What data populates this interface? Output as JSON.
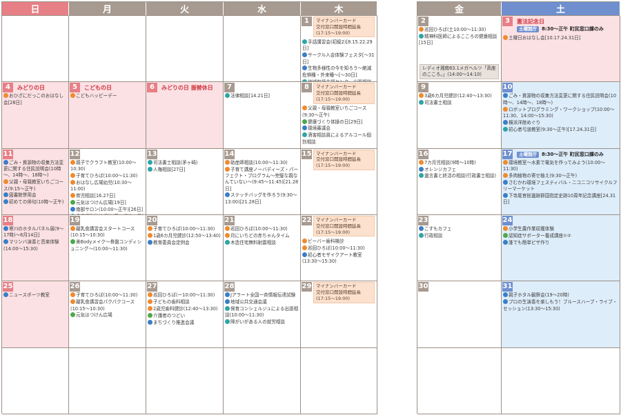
{
  "headers": {
    "sun": "日",
    "mon": "月",
    "tue": "火",
    "wed": "水",
    "thu": "木",
    "fri": "金",
    "sat": "土"
  },
  "notice": {
    "line1": "マイナンバーカード",
    "line2": "交付窓口開設時間延長",
    "line3": "(17:15～19:00)"
  },
  "sat_open": {
    "badge": "土曜開庁",
    "hours": "8:30～正午 町民窓口課のみ"
  },
  "days": {
    "d1": {
      "num": "1",
      "events": [
        {
          "icon": "t",
          "text": "手話講習会(初級2)[8.15.22.29日]"
        },
        {
          "icon": "b",
          "text": "サークル入会体験フェスタ[～31日]"
        },
        {
          "icon": "b",
          "text": "生物多様性の今を知ろう～絶滅危惧種・外来種～[～30日]"
        },
        {
          "icon": "t",
          "text": "地域包括支援センター出張相談[8.15.22.29日]"
        },
        {
          "icon": "t",
          "text": "消費生活相談[8.12.15.19.22.26.29日]"
        }
      ]
    },
    "d2": {
      "num": "2",
      "events": [
        {
          "icon": "o",
          "text": "巡回ひろば(土10:00～11:30)"
        },
        {
          "icon": "t",
          "text": "精神科医師によるこころの健康相談[15日]"
        }
      ],
      "radio": "レディオ湘南83.1メガヘルツ「高座のこころ。」(14:00～14:10)"
    },
    "d3": {
      "num": "3",
      "holiday": "憲法記念日",
      "events": [
        {
          "icon": "o",
          "text": "土曜日おはなし会[10.17.24.31日]"
        }
      ]
    },
    "d4": {
      "num": "4",
      "holiday": "みどりの日",
      "events": [
        {
          "icon": "o",
          "text": "おひざにだっこのおはなし会[28日]"
        }
      ]
    },
    "d5": {
      "num": "5",
      "holiday": "こどもの日",
      "events": [
        {
          "icon": "o",
          "text": "こどもハッピーデー"
        }
      ]
    },
    "d6": {
      "num": "6",
      "holiday": "みどりの日 振替休日",
      "events": []
    },
    "d7": {
      "num": "7",
      "events": [
        {
          "icon": "t",
          "text": "法律相談[14.21日]"
        }
      ]
    },
    "d8": {
      "num": "8",
      "events": [
        {
          "icon": "o",
          "text": "父親・母親教室いちごコース(9:30～正午)"
        },
        {
          "icon": "g",
          "text": "健康づくり体操の日[29日]"
        },
        {
          "icon": "b",
          "text": "環境審議会"
        },
        {
          "icon": "t",
          "text": "酒害相談員によるアルコール個別相談"
        }
      ]
    },
    "d9": {
      "num": "9",
      "events": [
        {
          "icon": "o",
          "text": "3歳6カ月児健診(12:40～13:30)"
        },
        {
          "icon": "t",
          "text": "司法書士相談"
        }
      ]
    },
    "d10": {
      "num": "10",
      "events": [
        {
          "icon": "b",
          "text": "ごみ・資源物の収集方法変更に関する住民説明会(10時～、14時～、18時～)"
        },
        {
          "icon": "o",
          "text": "ロボットプログラミング・ワークショップ(10:00～11:30、14:00～15:30)"
        },
        {
          "icon": "b",
          "text": "横浜洋館めぐり"
        },
        {
          "icon": "t",
          "text": "初心者弓道教室(9:30～正午)[17.24.31日]"
        }
      ]
    },
    "d11": {
      "num": "11",
      "events": [
        {
          "icon": "b",
          "text": "ごみ・資源物の収集方法変更に関する住民説明会(10時～、14時～、18時～)"
        },
        {
          "icon": "o",
          "text": "父親・母親教室いちごコース(9:15～正午)"
        },
        {
          "icon": "b",
          "text": "図書館併用会"
        },
        {
          "icon": "b",
          "text": "初めての俳句(10時～正午)"
        }
      ]
    },
    "d12": {
      "num": "12",
      "events": [
        {
          "icon": "o",
          "text": "親子でクラフト教室(10:00～10:30)"
        },
        {
          "icon": "o",
          "text": "子育てひろば(10:00～11:30)"
        },
        {
          "icon": "o",
          "text": "おはなし広場幼児(10:30～11:00)"
        },
        {
          "icon": "o",
          "text": "育児相談[16.27日]"
        },
        {
          "icon": "g",
          "text": "元気はつけん広場[19日]"
        },
        {
          "icon": "b",
          "text": "南部サロン(10:00～正午)[26日]"
        },
        {
          "icon": "t",
          "text": "多重債務法律相談(茅ヶ崎)[23日]"
        }
      ]
    },
    "d13": {
      "num": "13",
      "events": [
        {
          "icon": "t",
          "text": "司法書士相談(茅ヶ崎)"
        },
        {
          "icon": "t",
          "text": "人権相談[27日]"
        }
      ]
    },
    "d14": {
      "num": "14",
      "events": [
        {
          "icon": "o",
          "text": "助産師相談(10:00～11:30)"
        },
        {
          "icon": "o",
          "text": "子育て講座ノーバディーズ・パーフェクト・プログラム～完璧な親なんていない～(9:45～11:45)[21.28日]"
        },
        {
          "icon": "b",
          "text": "ステッチバッグを作ろう(9:30～13:00)[21.28日]"
        }
      ]
    },
    "d15": {
      "num": "15",
      "events": []
    },
    "d16": {
      "num": "16",
      "events": [
        {
          "icon": "o",
          "text": "7カ月児相談(9時～10時)"
        },
        {
          "icon": "b",
          "text": "オレンジカフェ"
        },
        {
          "icon": "t",
          "text": "遺言書と終活の相談(行政書士相談)"
        }
      ]
    },
    "d17": {
      "num": "17",
      "events": [
        {
          "icon": "o",
          "text": "環境教室～水素で電気を作ってみよう(10:00～11:30)"
        },
        {
          "icon": "o",
          "text": "多肉植物の寄せ植え(9:30～正午)"
        },
        {
          "icon": "b",
          "text": "さむかわ環境フェスティバル・ニコニコリサイクルフリーマーケット"
        },
        {
          "icon": "b",
          "text": "下寺尾官衙遺跡群国指定史跡10周年記念講座[24.31日]"
        }
      ]
    },
    "d18": {
      "num": "18",
      "events": [
        {
          "icon": "b",
          "text": "寒川のホタルパネル展(9～17時)～6月14日]"
        },
        {
          "icon": "b",
          "text": "マリンバ演奏と音楽体験(14:00～15:30)"
        }
      ]
    },
    "d19": {
      "num": "19",
      "events": [
        {
          "icon": "o",
          "text": "離乳食講習会スタートコース(10:15～10:30)"
        },
        {
          "icon": "g",
          "text": "美Bodyメイク～骨盤コンディショニング～(10:00～11:30)"
        }
      ]
    },
    "d20": {
      "num": "20",
      "events": [
        {
          "icon": "o",
          "text": "子育てひろば(10:00～11:30)"
        },
        {
          "icon": "o",
          "text": "1歳6カ月児健診(12:50～13:40)"
        },
        {
          "icon": "b",
          "text": "教育委員会定例会"
        }
      ]
    },
    "d21": {
      "num": "21",
      "events": [
        {
          "icon": "o",
          "text": "巡回ひろば(10:00～11:30)"
        },
        {
          "icon": "o",
          "text": "月にいちどの赤ちゃんタイム"
        },
        {
          "icon": "t",
          "text": "木造住宅無料耐震相談"
        }
      ]
    },
    "d22": {
      "num": "22",
      "events": [
        {
          "icon": "o",
          "text": "ビーバー歯科検診"
        },
        {
          "icon": "o",
          "text": "巡回ひろば(10:00～11:30)"
        },
        {
          "icon": "b",
          "text": "初心者モザイクアート教室(13:30～15:30)"
        }
      ]
    },
    "d23": {
      "num": "23",
      "events": [
        {
          "icon": "b",
          "text": "こすもカフェ"
        },
        {
          "icon": "t",
          "text": "行政相談"
        }
      ]
    },
    "d24": {
      "num": "24",
      "events": [
        {
          "icon": "o",
          "text": "小学生農作業収穫体験"
        },
        {
          "icon": "g",
          "text": "認知症サポーター養成講座①②"
        },
        {
          "icon": "b",
          "text": "誰でも簡単ピザ作り"
        }
      ]
    },
    "d25": {
      "num": "25",
      "events": [
        {
          "icon": "b",
          "text": "ニュースポーツ教室"
        }
      ]
    },
    "d26": {
      "num": "26",
      "events": [
        {
          "icon": "o",
          "text": "子育てひろば(10:00～11:30)"
        },
        {
          "icon": "o",
          "text": "離乳食講習会パクパクコース(10:15～10:30)"
        },
        {
          "icon": "g",
          "text": "元気はつけん広場"
        }
      ]
    },
    "d27": {
      "num": "27",
      "events": [
        {
          "icon": "o",
          "text": "巡回ひろば(ー10:00～11:30)"
        },
        {
          "icon": "o",
          "text": "子どもの歯科相談"
        },
        {
          "icon": "o",
          "text": "2歳児歯科健診(12:40～13:30)"
        },
        {
          "icon": "g",
          "text": "介護者のつどい"
        },
        {
          "icon": "b",
          "text": "まちづくり推進会議"
        }
      ]
    },
    "d28": {
      "num": "28",
      "events": [
        {
          "icon": "b",
          "text": "Jアラート全国一斉情報伝達試験"
        },
        {
          "icon": "b",
          "text": "地域公共交通会議"
        },
        {
          "icon": "t",
          "text": "保育コンシェルジュによる出張相談(10:00～11:30)"
        },
        {
          "icon": "t",
          "text": "障がいがある人の就労相談"
        }
      ]
    },
    "d29": {
      "num": "29",
      "events": []
    },
    "d30": {
      "num": "30",
      "events": []
    },
    "d31": {
      "num": "31",
      "events": [
        {
          "icon": "b",
          "text": "親子ホタル観察会(19～20時)"
        },
        {
          "icon": "b",
          "text": "プロの生演奏を楽しもう！ブルースハープ・ライブ・セッション(13:30～15:30)"
        }
      ]
    }
  }
}
